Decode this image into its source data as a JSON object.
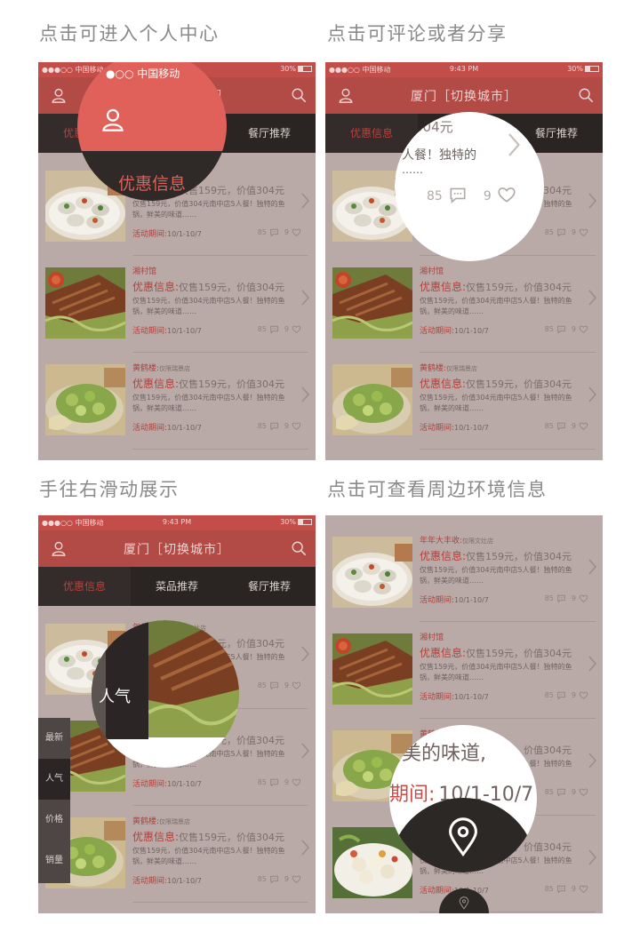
{
  "captions": [
    "点击可进入个人中心",
    "点击可评论或者分享",
    "手往右滑动展示",
    "点击可查看周边环境信息"
  ],
  "status": {
    "carrier": "●●●○○ 中国移动",
    "time": "9:43 PM",
    "battery": "30%"
  },
  "header": {
    "title": "厦门［切换城市］"
  },
  "tabs": [
    "优惠信息",
    "菜品推荐",
    "餐厅推荐"
  ],
  "items": [
    {
      "shop": "年年大丰收:",
      "branch": "仅限文灶店",
      "offer_label": "优惠信息:",
      "offer_text": "仅售159元，价值304元",
      "desc": "仅售159元，价值304元南中店5人餐！独特的鱼锅，鲜美的味道……",
      "period_label": "活动期间:",
      "period": "10/1-10/7",
      "comments": "85",
      "likes": "9"
    },
    {
      "shop": "湘村馆",
      "branch": "",
      "offer_label": "优惠信息:",
      "offer_text": "仅售159元，价值304元",
      "desc": "仅售159元，价值304元南中店5人餐！独特的鱼锅，鲜美的味道……",
      "period_label": "活动期间:",
      "period": "10/1-10/7",
      "comments": "85",
      "likes": "9"
    },
    {
      "shop": "黄鹤楼:",
      "branch": "仅限瑞景店",
      "offer_label": "优惠信息:",
      "offer_text": "仅售159元，价值304元",
      "desc": "仅售159元，价值304元南中店5人餐！独特的鱼锅，鲜美的味道……",
      "period_label": "活动期间:",
      "period": "10/1-10/7",
      "comments": "85",
      "likes": "9"
    }
  ],
  "mag1": {
    "carrier": "●○○ 中国移动",
    "tab": "优惠信息"
  },
  "mag2": {
    "price": "304元",
    "desc1": "人餐！独特的",
    "desc2": "……",
    "comments": "85",
    "likes": "9"
  },
  "mag3": {
    "label": "人气"
  },
  "mag4": {
    "desc": "美的味道,",
    "period_label": "期间:",
    "period": "10/1-10/7"
  },
  "side_menu": [
    "最新",
    "人气",
    "价格",
    "销量"
  ],
  "colors": {
    "brand": "#c34d48",
    "dark": "#2a2523",
    "overlay": "#b9aaa7"
  }
}
